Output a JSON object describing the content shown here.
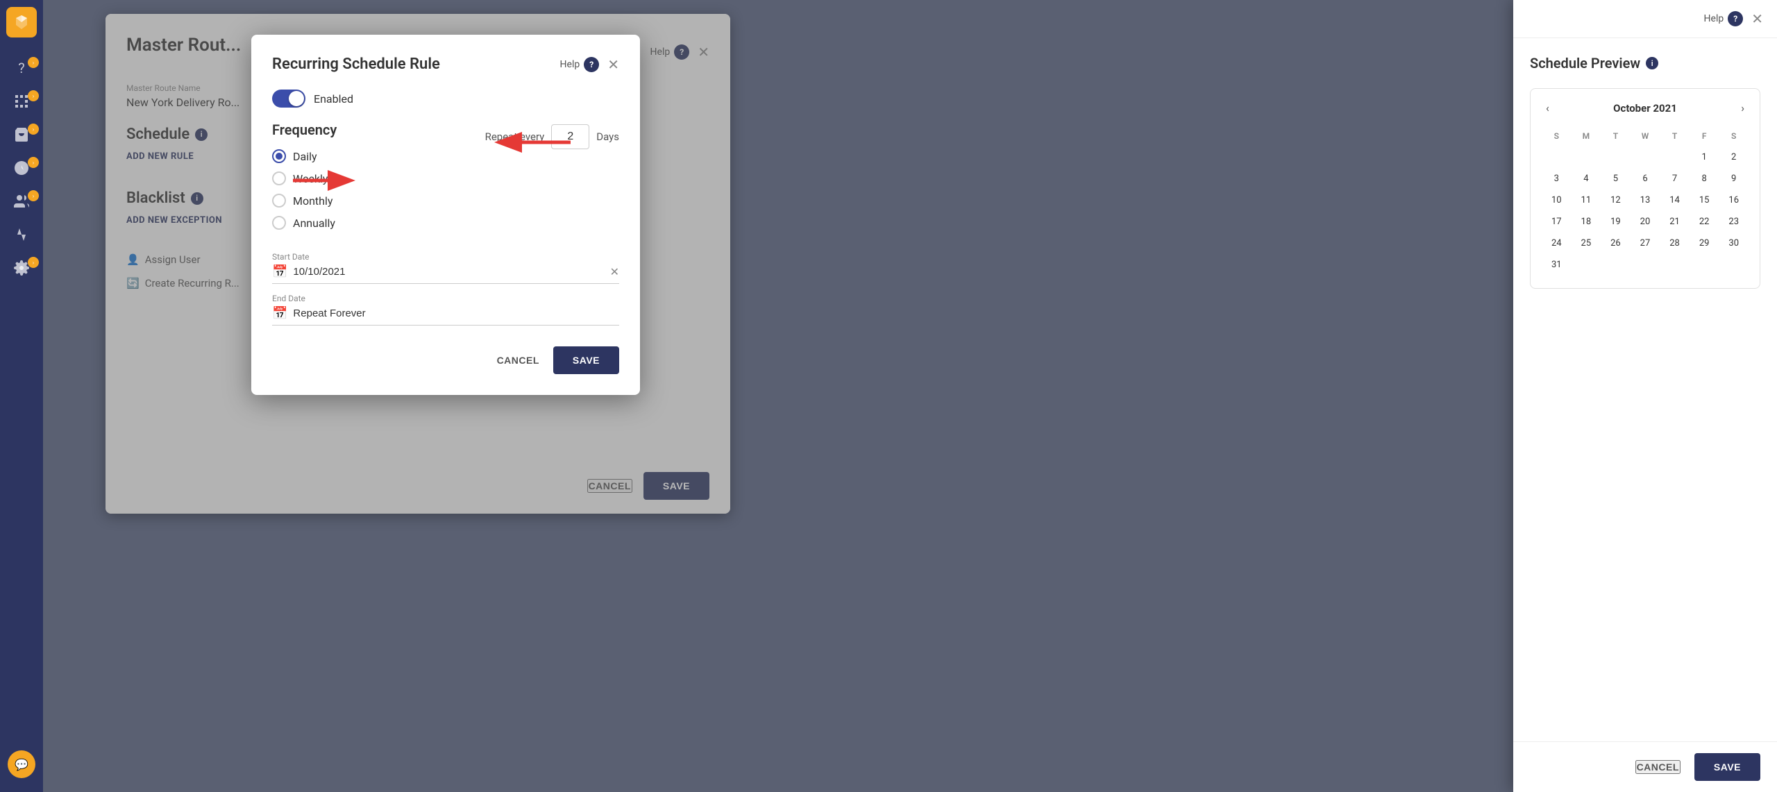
{
  "sidebar": {
    "items": [
      {
        "label": "help",
        "icon": "?"
      },
      {
        "label": "routes",
        "icon": "routes"
      },
      {
        "label": "cart",
        "icon": "cart"
      },
      {
        "label": "dispatch",
        "icon": "dispatch"
      },
      {
        "label": "users",
        "icon": "users"
      },
      {
        "label": "analytics",
        "icon": "analytics"
      },
      {
        "label": "settings",
        "icon": "settings"
      }
    ],
    "chat_icon": "💬"
  },
  "bg_panel": {
    "title": "Master Rout...",
    "help_label": "Help",
    "field_label": "Master Route Name",
    "field_value": "New York Delivery Ro...",
    "schedule_section": "Schedule",
    "add_rule_btn": "ADD NEW RULE",
    "blacklist_section": "Blacklist",
    "add_exception_btn": "ADD NEW EXCEPTION",
    "assign_user": "Assign User",
    "create_recurring": "Create Recurring R...",
    "cancel_btn": "CANCEL",
    "save_btn": "SAVE"
  },
  "dialog": {
    "title": "Recurring Schedule Rule",
    "help_label": "Help",
    "enabled_label": "Enabled",
    "frequency_title": "Frequency",
    "options": [
      {
        "id": "daily",
        "label": "Daily",
        "selected": true
      },
      {
        "id": "weekly",
        "label": "Weekly",
        "selected": false
      },
      {
        "id": "monthly",
        "label": "Monthly",
        "selected": false
      },
      {
        "id": "annually",
        "label": "Annually",
        "selected": false
      }
    ],
    "repeat_label": "Repeat every",
    "repeat_value": "2",
    "repeat_unit": "Days",
    "start_date_label": "Start Date",
    "start_date_value": "10/10/2021",
    "end_date_label": "End Date",
    "end_date_value": "Repeat Forever",
    "cancel_btn": "CANCEL",
    "save_btn": "SAVE"
  },
  "schedule_preview": {
    "title": "Schedule Preview",
    "help_label": "Help",
    "month": "October 2021",
    "days_header": [
      "S",
      "M",
      "T",
      "W",
      "T",
      "F",
      "S"
    ],
    "weeks": [
      [
        null,
        null,
        null,
        null,
        null,
        1,
        2
      ],
      [
        3,
        4,
        5,
        6,
        7,
        8,
        9
      ],
      [
        10,
        11,
        12,
        13,
        14,
        15,
        16
      ],
      [
        17,
        18,
        19,
        20,
        21,
        22,
        23
      ],
      [
        24,
        25,
        26,
        27,
        28,
        29,
        30
      ],
      [
        31,
        null,
        null,
        null,
        null,
        null,
        null
      ]
    ],
    "highlighted_dark": [
      10,
      12,
      14,
      16,
      18,
      20,
      22,
      24,
      26,
      28,
      30
    ],
    "highlighted_light": [],
    "cancel_btn": "CANCEL",
    "save_btn": "SAVE"
  },
  "arrows": {
    "left_arrow_label": "points to Daily radio",
    "right_arrow_label": "points to repeat input"
  }
}
